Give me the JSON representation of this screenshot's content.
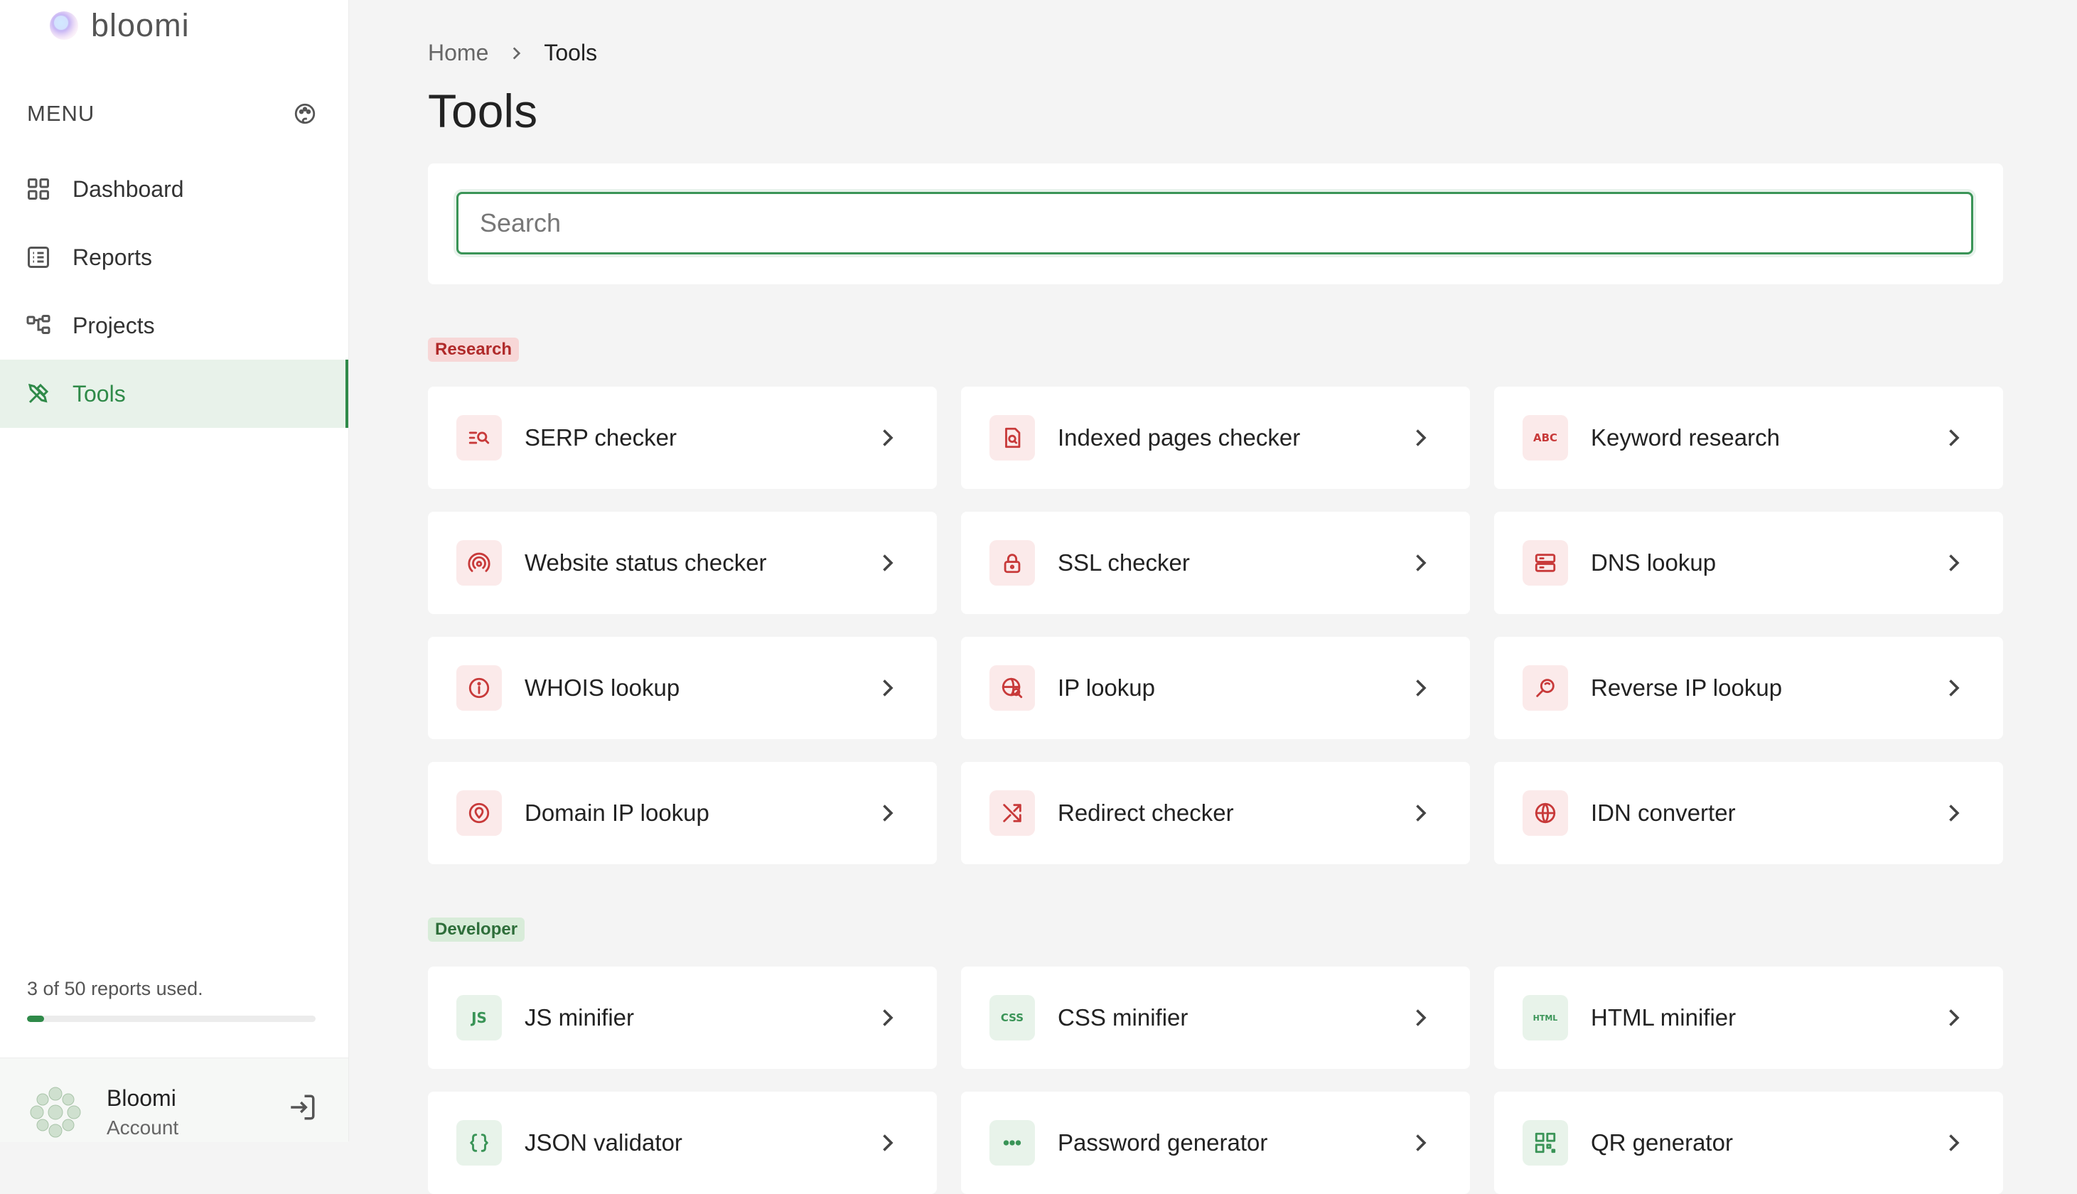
{
  "app": {
    "name": "bloomi"
  },
  "sidebar": {
    "menu_label": "MENU",
    "items": [
      {
        "label": "Dashboard",
        "icon": "grid-icon",
        "active": false
      },
      {
        "label": "Reports",
        "icon": "list-icon",
        "active": false
      },
      {
        "label": "Projects",
        "icon": "tree-icon",
        "active": false
      },
      {
        "label": "Tools",
        "icon": "tools-icon",
        "active": true
      }
    ],
    "usage": {
      "text": "3 of 50 reports used.",
      "used": 3,
      "total": 50
    },
    "account": {
      "name": "Bloomi",
      "subtitle": "Account"
    }
  },
  "breadcrumb": {
    "home": "Home",
    "current": "Tools"
  },
  "page": {
    "title": "Tools"
  },
  "search": {
    "placeholder": "Search",
    "value": ""
  },
  "sections": [
    {
      "badge": "Research",
      "items": [
        {
          "label": "SERP checker",
          "icon": "serp-icon"
        },
        {
          "label": "Indexed pages checker",
          "icon": "indexed-page-icon"
        },
        {
          "label": "Keyword research",
          "icon": "abc-icon",
          "icon_text": "ABC"
        },
        {
          "label": "Website status checker",
          "icon": "status-signal-icon"
        },
        {
          "label": "SSL checker",
          "icon": "lock-icon"
        },
        {
          "label": "DNS lookup",
          "icon": "server-icon"
        },
        {
          "label": "WHOIS lookup",
          "icon": "info-icon"
        },
        {
          "label": "IP lookup",
          "icon": "globe-search-icon"
        },
        {
          "label": "Reverse IP lookup",
          "icon": "reverse-search-icon"
        },
        {
          "label": "Domain IP lookup",
          "icon": "location-pin-icon"
        },
        {
          "label": "Redirect checker",
          "icon": "shuffle-icon"
        },
        {
          "label": "IDN converter",
          "icon": "globe-icon"
        }
      ]
    },
    {
      "badge": "Developer",
      "items": [
        {
          "label": "JS minifier",
          "icon": "js-icon",
          "icon_text": "JS"
        },
        {
          "label": "CSS minifier",
          "icon": "css-icon",
          "icon_text": "CSS"
        },
        {
          "label": "HTML minifier",
          "icon": "html-icon",
          "icon_text": "HTML"
        },
        {
          "label": "JSON validator",
          "icon": "braces-icon"
        },
        {
          "label": "Password generator",
          "icon": "dots-icon"
        },
        {
          "label": "QR generator",
          "icon": "qr-icon"
        }
      ]
    }
  ],
  "colors": {
    "accent": "#2f8a49",
    "research": "#c83a3a",
    "developer": "#3a9457"
  }
}
